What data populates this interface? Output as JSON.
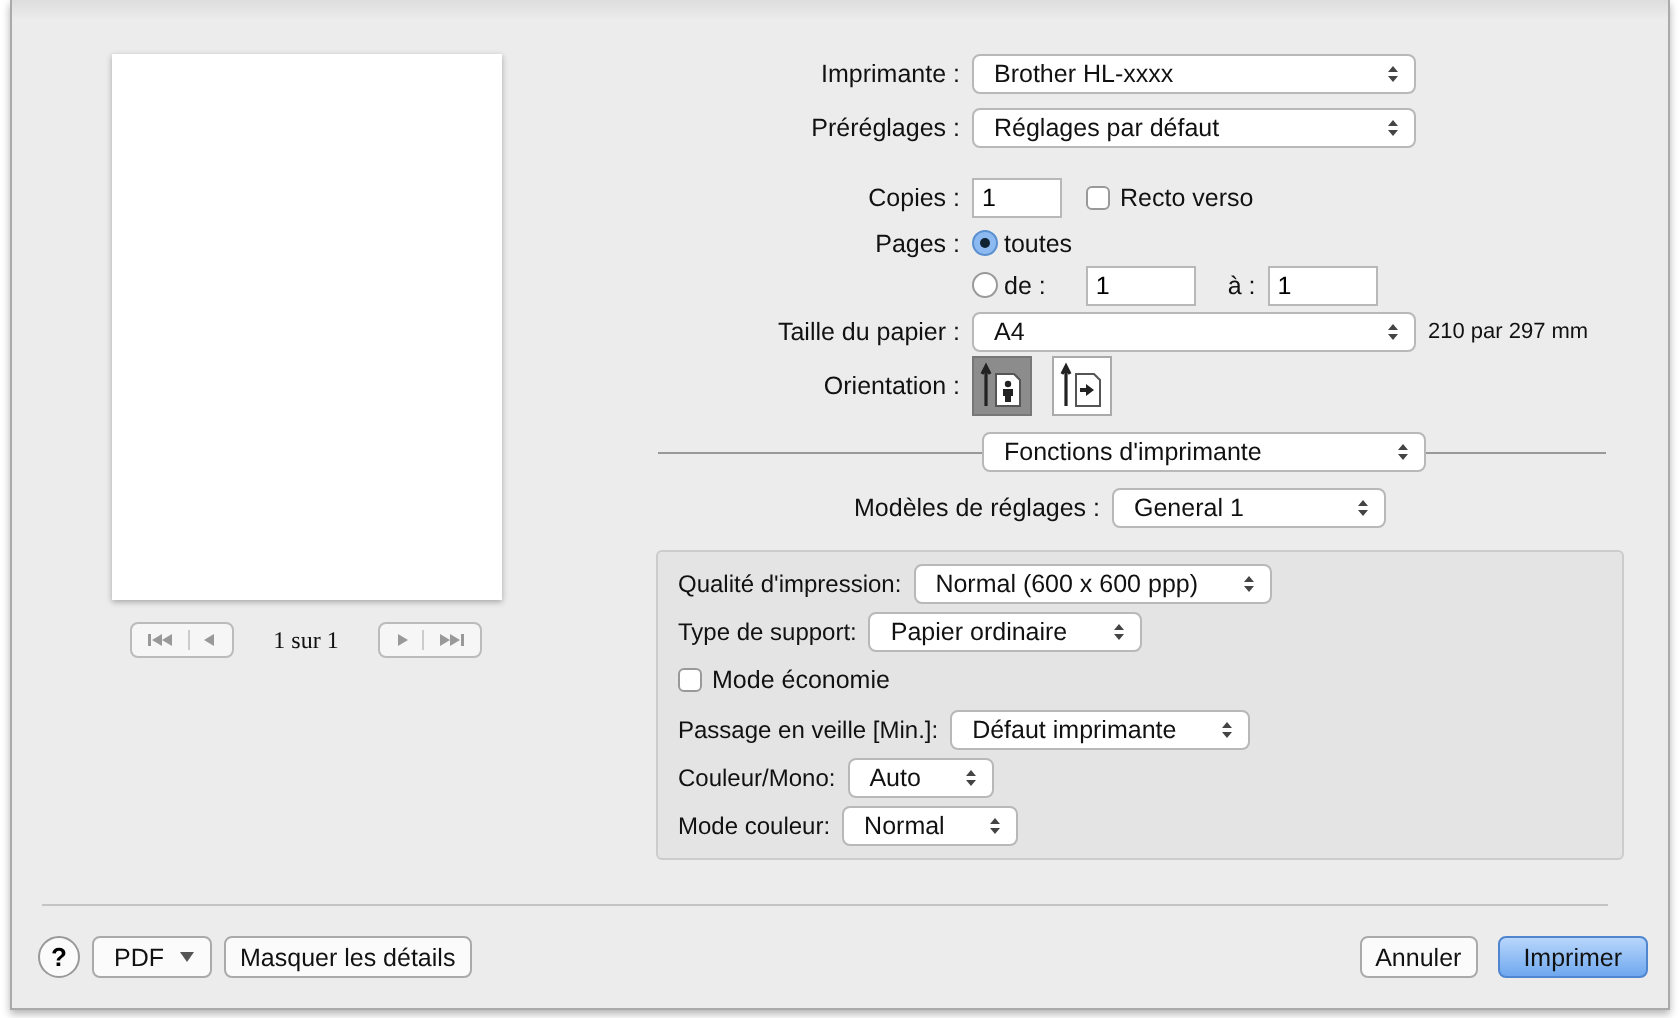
{
  "preview": {
    "page_counter": "1 sur 1"
  },
  "printer": {
    "label": "Imprimante :",
    "value": "Brother HL-xxxx"
  },
  "presets": {
    "label": "Préréglages :",
    "value": "Réglages par défaut"
  },
  "copies": {
    "label": "Copies :",
    "value": "1"
  },
  "duplex": {
    "label": "Recto verso",
    "checked": false
  },
  "pages": {
    "label": "Pages :",
    "options": [
      {
        "label": "toutes",
        "selected": true
      },
      {
        "label": "de :",
        "selected": false
      }
    ],
    "from": "1",
    "to_label": "à :",
    "to": "1"
  },
  "paper_size": {
    "label": "Taille du papier :",
    "value": "A4",
    "dimensions": "210 par 297 mm"
  },
  "orientation": {
    "label": "Orientation :",
    "options": [
      {
        "kind": "portrait",
        "selected": true
      },
      {
        "kind": "landscape",
        "selected": false
      }
    ]
  },
  "section_popup": "Fonctions d'imprimante",
  "template": {
    "label": "Modèles de réglages :",
    "value": "General 1"
  },
  "settings": [
    {
      "kind": "select",
      "label": "Qualité d'impression:",
      "value": "Normal (600 x 600 ppp)"
    },
    {
      "kind": "select",
      "label": "Type de support:",
      "value": "Papier ordinaire"
    },
    {
      "kind": "checkbox",
      "label": "Mode économie",
      "checked": false
    },
    {
      "kind": "select",
      "label": "Passage en veille [Min.]:",
      "value": "Défaut imprimante"
    },
    {
      "kind": "select",
      "label": "Couleur/Mono:",
      "value": "Auto"
    },
    {
      "kind": "select",
      "label": "Mode couleur:",
      "value": "Normal"
    }
  ],
  "footer": {
    "help": "?",
    "pdf": "PDF",
    "details": "Masquer les détails",
    "cancel": "Annuler",
    "print": "Imprimer"
  }
}
